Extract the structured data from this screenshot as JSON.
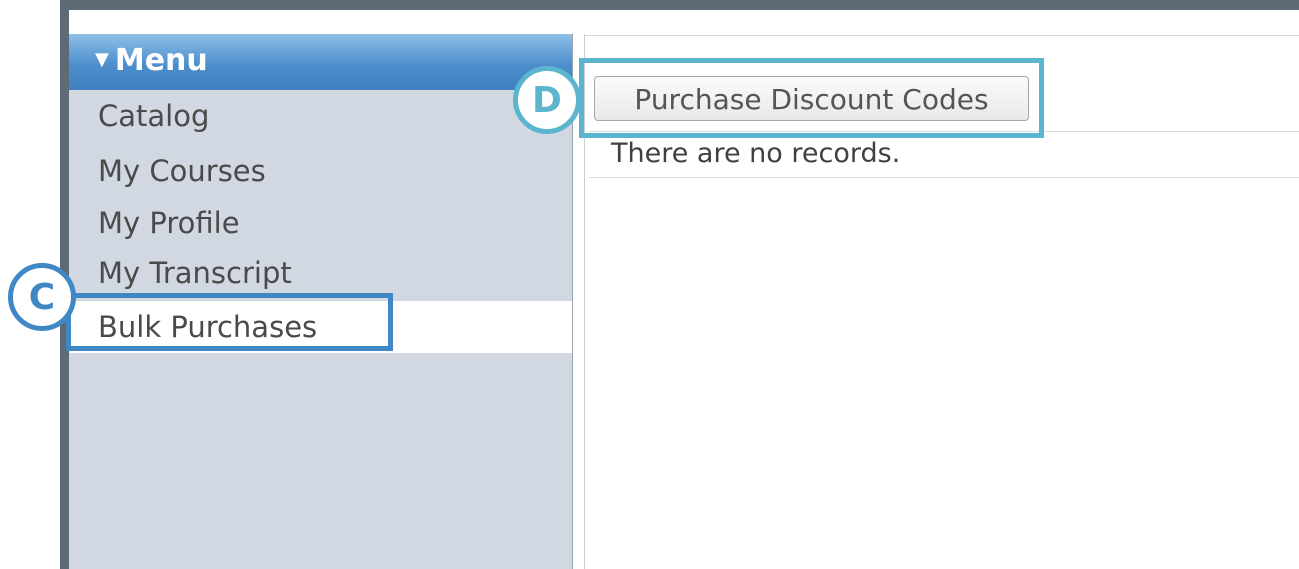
{
  "menu": {
    "header": "Menu",
    "items": [
      {
        "label": "Catalog"
      },
      {
        "label": "My Courses"
      },
      {
        "label": "My Profile"
      },
      {
        "label": "My Transcript"
      },
      {
        "label": "Bulk Purchases",
        "active": true
      }
    ]
  },
  "content": {
    "purchase_button_label": "Purchase Discount Codes",
    "empty_message": "There are no records."
  },
  "annotations": {
    "c_label": "C",
    "d_label": "D"
  },
  "colors": {
    "menu_header": "#4d8fcc",
    "sidebar_bg": "#d2d8e2",
    "callout_c": "#3f87c5",
    "callout_d": "#5cb5cf"
  }
}
